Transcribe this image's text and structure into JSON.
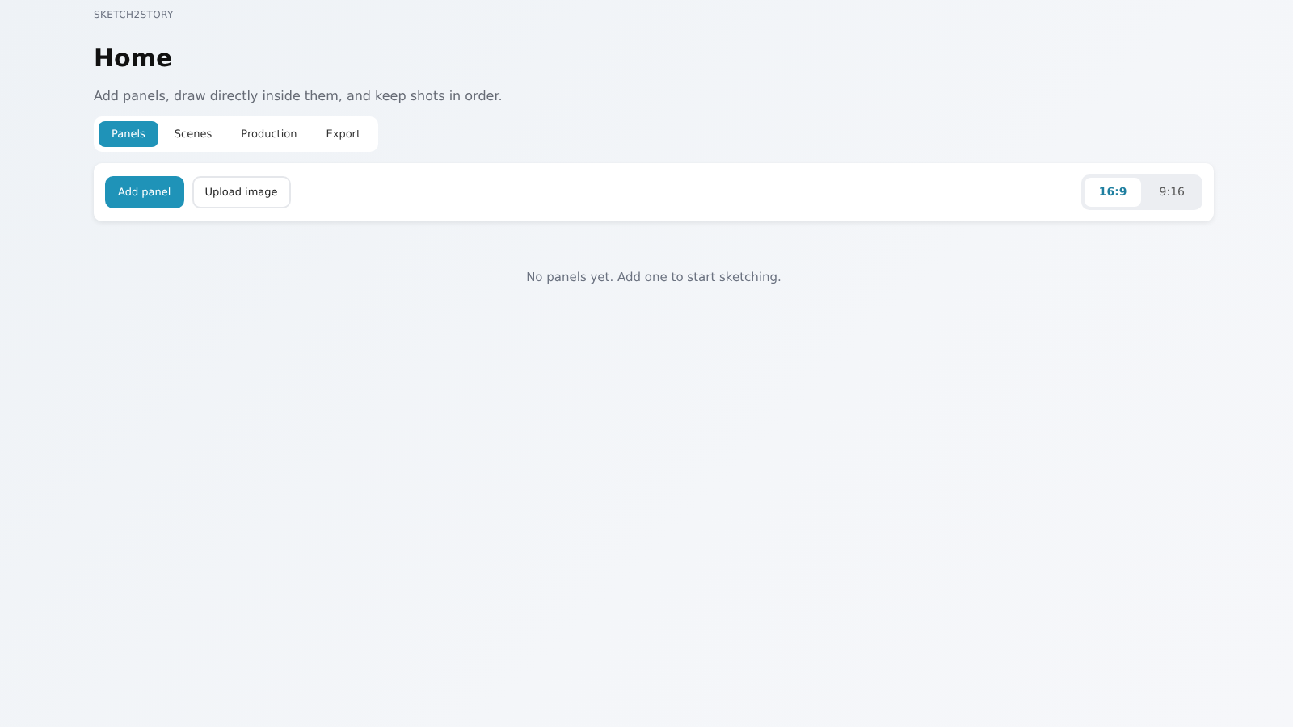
{
  "brand": "SKETCH2STORY",
  "title": "Home",
  "subtitle": "Add panels, draw directly inside them, and keep shots in order.",
  "tabs": [
    {
      "label": "Panels",
      "selected": true
    },
    {
      "label": "Scenes",
      "selected": false
    },
    {
      "label": "Production",
      "selected": false
    },
    {
      "label": "Export",
      "selected": false
    }
  ],
  "toolbar": {
    "buttons": [
      {
        "label": "Add panel",
        "kind": "primary"
      },
      {
        "label": "Upload image",
        "kind": "secondary"
      }
    ],
    "aspect": [
      {
        "label": "16:9",
        "selected": true
      },
      {
        "label": "9:16",
        "selected": false
      }
    ]
  },
  "empty_message": "No panels yet. Add one to start sketching."
}
